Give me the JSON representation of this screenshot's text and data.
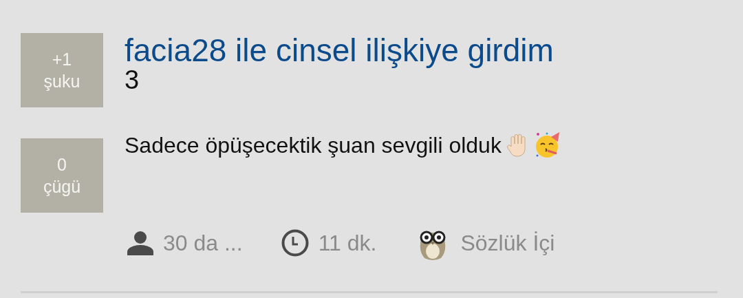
{
  "entry": {
    "title": "facia28 ile cinsel ilişkiye girdim",
    "number": "3",
    "body": "Sadece öpüşecektik şuan sevgili olduk"
  },
  "votes": [
    {
      "count": "+1",
      "label": "şuku"
    },
    {
      "count": "0",
      "label": "çügü"
    }
  ],
  "meta": [
    {
      "kind": "author",
      "text": "30 da ..."
    },
    {
      "kind": "time",
      "text": "11 dk."
    },
    {
      "kind": "channel",
      "text": "Sözlük İçi"
    }
  ]
}
